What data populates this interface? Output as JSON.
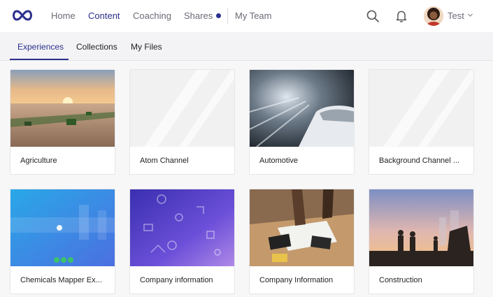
{
  "header": {
    "nav": [
      {
        "label": "Home",
        "active": false
      },
      {
        "label": "Content",
        "active": true
      },
      {
        "label": "Coaching",
        "active": false
      },
      {
        "label": "Shares",
        "active": false
      },
      {
        "label": "My Team",
        "active": false
      }
    ],
    "user_name": "Test",
    "icons": [
      "logo-infinity-icon",
      "search-icon",
      "bell-icon",
      "chevron-down-icon"
    ]
  },
  "tabs": [
    {
      "label": "Experiences",
      "active": true
    },
    {
      "label": "Collections",
      "active": false
    },
    {
      "label": "My Files",
      "active": false
    }
  ],
  "cards": [
    {
      "label": "Agriculture"
    },
    {
      "label": "Atom Channel"
    },
    {
      "label": "Automotive"
    },
    {
      "label": "Background Channel ..."
    },
    {
      "label": "Chemicals Mapper Ex..."
    },
    {
      "label": "Company information"
    },
    {
      "label": "Company Information"
    },
    {
      "label": "Construction"
    }
  ],
  "colors": {
    "accent": "#2b2f8c",
    "tab_bg": "#f3f3f5",
    "page_bg": "#f7f7f8"
  }
}
